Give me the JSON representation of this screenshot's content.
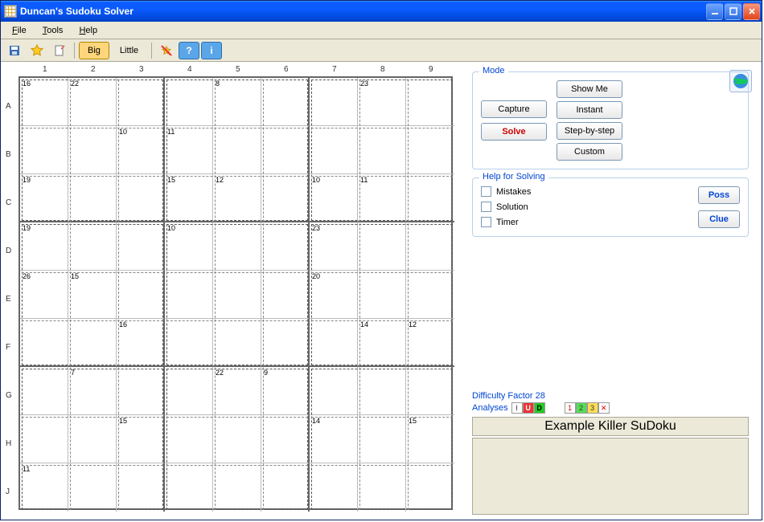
{
  "window": {
    "title": "Duncan's Sudoku Solver"
  },
  "menu": {
    "file": "File",
    "tools": "Tools",
    "help": "Help"
  },
  "toolbar": {
    "big": "Big",
    "little": "Little"
  },
  "grid": {
    "cols": [
      "1",
      "2",
      "3",
      "4",
      "5",
      "6",
      "7",
      "8",
      "9"
    ],
    "rows": [
      "A",
      "B",
      "C",
      "D",
      "E",
      "F",
      "G",
      "H",
      "J"
    ],
    "cages": [
      {
        "label": "16",
        "r": 0,
        "c": 0
      },
      {
        "label": "22",
        "r": 0,
        "c": 1
      },
      {
        "label": "8",
        "r": 0,
        "c": 4
      },
      {
        "label": "23",
        "r": 0,
        "c": 7
      },
      {
        "label": "10",
        "r": 1,
        "c": 2
      },
      {
        "label": "11",
        "r": 1,
        "c": 3
      },
      {
        "label": "19",
        "r": 2,
        "c": 0
      },
      {
        "label": "15",
        "r": 2,
        "c": 3
      },
      {
        "label": "12",
        "r": 2,
        "c": 4
      },
      {
        "label": "10",
        "r": 2,
        "c": 6
      },
      {
        "label": "11",
        "r": 2,
        "c": 7
      },
      {
        "label": "19",
        "r": 3,
        "c": 0
      },
      {
        "label": "10",
        "r": 3,
        "c": 3
      },
      {
        "label": "23",
        "r": 3,
        "c": 6
      },
      {
        "label": "26",
        "r": 4,
        "c": 0
      },
      {
        "label": "15",
        "r": 4,
        "c": 1
      },
      {
        "label": "20",
        "r": 4,
        "c": 6
      },
      {
        "label": "16",
        "r": 5,
        "c": 2
      },
      {
        "label": "14",
        "r": 5,
        "c": 7
      },
      {
        "label": "12",
        "r": 5,
        "c": 8
      },
      {
        "label": "7",
        "r": 6,
        "c": 1
      },
      {
        "label": "22",
        "r": 6,
        "c": 4
      },
      {
        "label": "9",
        "r": 6,
        "c": 5
      },
      {
        "label": "15",
        "r": 7,
        "c": 2
      },
      {
        "label": "14",
        "r": 7,
        "c": 6
      },
      {
        "label": "15",
        "r": 7,
        "c": 8
      },
      {
        "label": "11",
        "r": 8,
        "c": 0
      }
    ]
  },
  "mode": {
    "legend": "Mode",
    "capture": "Capture",
    "solve": "Solve",
    "showme": "Show Me",
    "instant": "Instant",
    "stepbystep": "Step-by-step",
    "custom": "Custom"
  },
  "help": {
    "legend": "Help for Solving",
    "mistakes": "Mistakes",
    "solution": "Solution",
    "timer": "Timer",
    "poss": "Poss",
    "clue": "Clue"
  },
  "difficulty": "Difficulty Factor 28",
  "analyses_label": "Analyses",
  "status_title": "Example Killer SuDoku"
}
